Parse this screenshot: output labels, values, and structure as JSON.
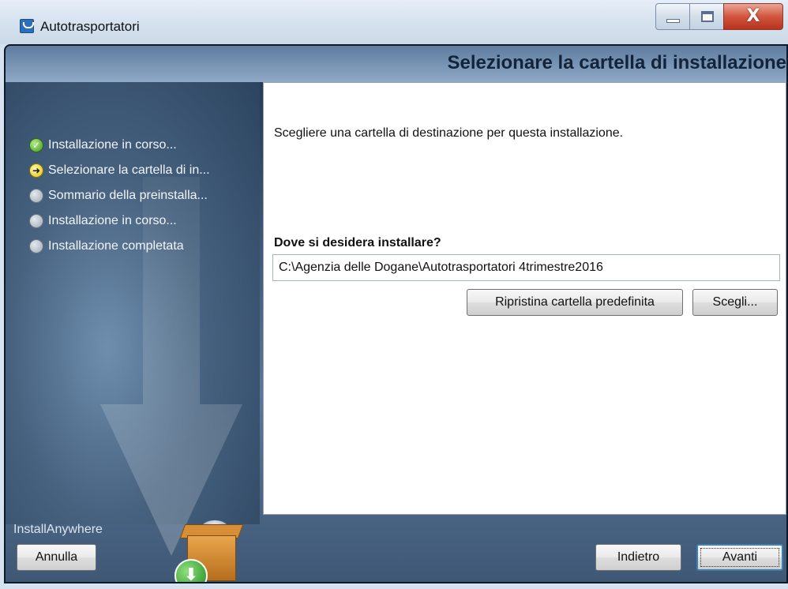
{
  "window": {
    "title": "Autotrasportatori",
    "close_glyph": "X"
  },
  "header": {
    "title": "Selezionare la cartella di installazione"
  },
  "steps": [
    {
      "label": "Installazione in corso...",
      "status": "done"
    },
    {
      "label": "Selezionare la cartella di in...",
      "status": "current"
    },
    {
      "label": "Sommario della preinstalla...",
      "status": "pending"
    },
    {
      "label": "Installazione in corso...",
      "status": "pending"
    },
    {
      "label": "Installazione completata",
      "status": "pending"
    }
  ],
  "content": {
    "intro": "Scegliere una cartella di destinazione per questa installazione.",
    "question": "Dove si desidera installare?",
    "path_value": "C:\\Agenzia delle Dogane\\Autotrasportatori 4trimestre2016",
    "restore_button": "Ripristina cartella predefinita",
    "choose_button": "Scegli..."
  },
  "footer": {
    "brand": "InstallAnywhere",
    "cancel_button": "Annulla",
    "back_button": "Indietro",
    "next_button": "Avanti"
  },
  "icons": {
    "app": "installer-app-icon",
    "step_done": "checkmark-icon",
    "step_current": "arrow-right-icon",
    "step_pending": "gray-circle-icon",
    "download": "download-arrow-icon"
  },
  "colors": {
    "header_title": "#13243a",
    "panel_dark": "#2c4460",
    "close_button": "#d2563f",
    "default_button_border": "#3c7fb1"
  }
}
